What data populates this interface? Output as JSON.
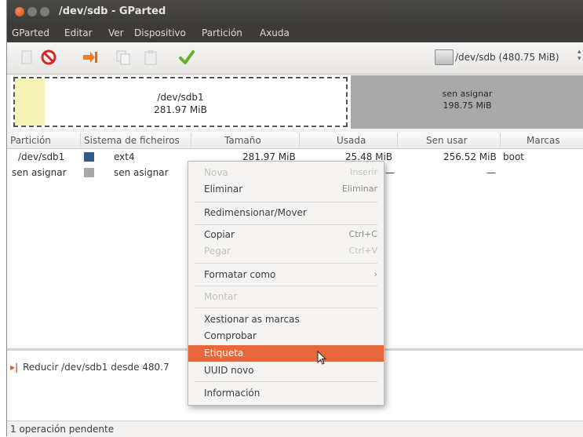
{
  "window": {
    "title": "/dev/sdb - GParted"
  },
  "menubar": {
    "items": [
      "GParted",
      "Editar",
      "Ver",
      "Dispositivo",
      "Partición",
      "Axuda"
    ]
  },
  "toolbar": {
    "buttons": [
      "new-icon",
      "delete-icon",
      "resize-move-icon",
      "copy-icon",
      "paste-icon",
      "apply-icon"
    ],
    "device": "/dev/sdb  (480.75 MiB)"
  },
  "disk_map": {
    "partition": {
      "name": "/dev/sdb1",
      "size": "281.97 MiB"
    },
    "unallocated": {
      "name": "sen asignar",
      "size": "198.75 MiB"
    }
  },
  "table": {
    "columns": [
      "Partición",
      "Sistema de ficheiros",
      "Tamaño",
      "Usada",
      "Sen usar",
      "Marcas"
    ],
    "rows": [
      {
        "partition": "/dev/sdb1",
        "fs_color": "#2c5d8b",
        "filesystem": "ext4",
        "size": "281.97 MiB",
        "used": "25.48 MiB",
        "unused": "256.52 MiB",
        "flags": "boot"
      },
      {
        "partition": "sen asignar",
        "fs_color": "#a8a8a8",
        "filesystem": "sen asignar",
        "size": "",
        "used": "—",
        "unused": "—",
        "flags": ""
      }
    ]
  },
  "pending": {
    "operation": "Reducir /dev/sdb1 desde 480.7"
  },
  "statusbar": {
    "text": "1 operación pendente"
  },
  "context_menu": {
    "new": {
      "label": "Nova",
      "accel": "Inserir"
    },
    "delete": {
      "label": "Eliminar",
      "accel": "Eliminar"
    },
    "resize": {
      "label": "Redimensionar/Mover"
    },
    "copy": {
      "label": "Copiar",
      "accel": "Ctrl+C"
    },
    "paste": {
      "label": "Pegar",
      "accel": "Ctrl+V"
    },
    "format": {
      "label": "Formatar como",
      "accel": "›"
    },
    "mount": {
      "label": "Montar"
    },
    "manage_flags": {
      "label": "Xestionar as marcas"
    },
    "check": {
      "label": "Comprobar"
    },
    "label_item": {
      "label": "Etiqueta"
    },
    "new_uuid": {
      "label": "UUID novo"
    },
    "info": {
      "label": "Información"
    }
  },
  "colors": {
    "accent": "#e7693b",
    "titlebar": "#3c3b37",
    "ext4": "#2c5d8b",
    "unallocated": "#a8a8a8"
  }
}
